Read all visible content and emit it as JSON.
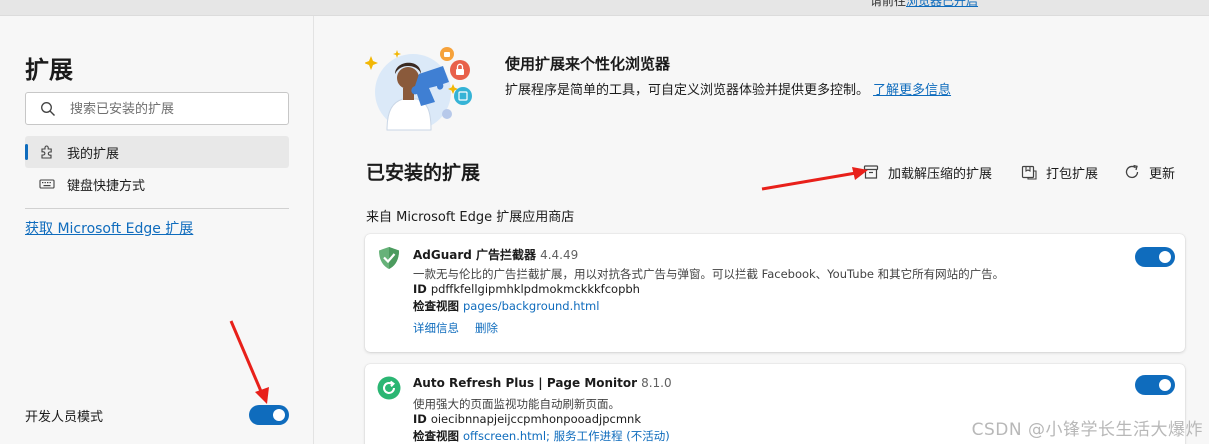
{
  "topbar": {
    "hint_prefix": "请前往",
    "hint_link": "浏览器已开启"
  },
  "sidebar": {
    "title": "扩展",
    "search_placeholder": "搜索已安装的扩展",
    "nav": [
      {
        "label": "我的扩展",
        "icon": "puzzle-icon",
        "active": true
      },
      {
        "label": "键盘快捷方式",
        "icon": "keyboard-icon",
        "active": false
      }
    ],
    "store_link": "获取 Microsoft Edge 扩展",
    "dev_mode_label": "开发人员模式",
    "dev_mode_on": true
  },
  "hero": {
    "title": "使用扩展来个性化浏览器",
    "desc": "扩展程序是简单的工具，可自定义浏览器体验并提供更多控制。",
    "learn_more": "了解更多信息"
  },
  "installed": {
    "title": "已安装的扩展",
    "actions": [
      {
        "label": "加载解压缩的扩展",
        "icon": "box-icon"
      },
      {
        "label": "打包扩展",
        "icon": "package-icon"
      },
      {
        "label": "更新",
        "icon": "refresh-icon"
      }
    ],
    "source_label": "来自 Microsoft Edge 扩展应用商店"
  },
  "extensions": [
    {
      "name": "AdGuard 广告拦截器",
      "version": "4.4.49",
      "desc": "一款无与伦比的广告拦截扩展，用以对抗各式广告与弹窗。可以拦截 Facebook、YouTube 和其它所有网站的广告。",
      "id_label": "ID",
      "id": "pdffkfellgipmhklpdmokmckkkfcopbh",
      "view_label": "检查视图",
      "view_link": "pages/background.html",
      "details": "详细信息",
      "remove": "删除",
      "enabled": true,
      "icon": "adguard-shield-icon",
      "icon_color": "#67b279"
    },
    {
      "name": "Auto Refresh Plus | Page Monitor",
      "version": "8.1.0",
      "desc": "使用强大的页面监视功能自动刷新页面。",
      "id_label": "ID",
      "id": "oiecibnnapjeijccpmhonpooadjpcmnk",
      "view_label": "检查视图",
      "view_link": "offscreen.html; 服务工作进程 (不活动)",
      "enabled": true,
      "icon": "auto-refresh-icon",
      "icon_color": "#2bb673"
    }
  ],
  "watermark": "CSDN @小锋学长生活大爆炸",
  "colors": {
    "accent": "#0f6cbd",
    "arrow": "#e8201a"
  }
}
